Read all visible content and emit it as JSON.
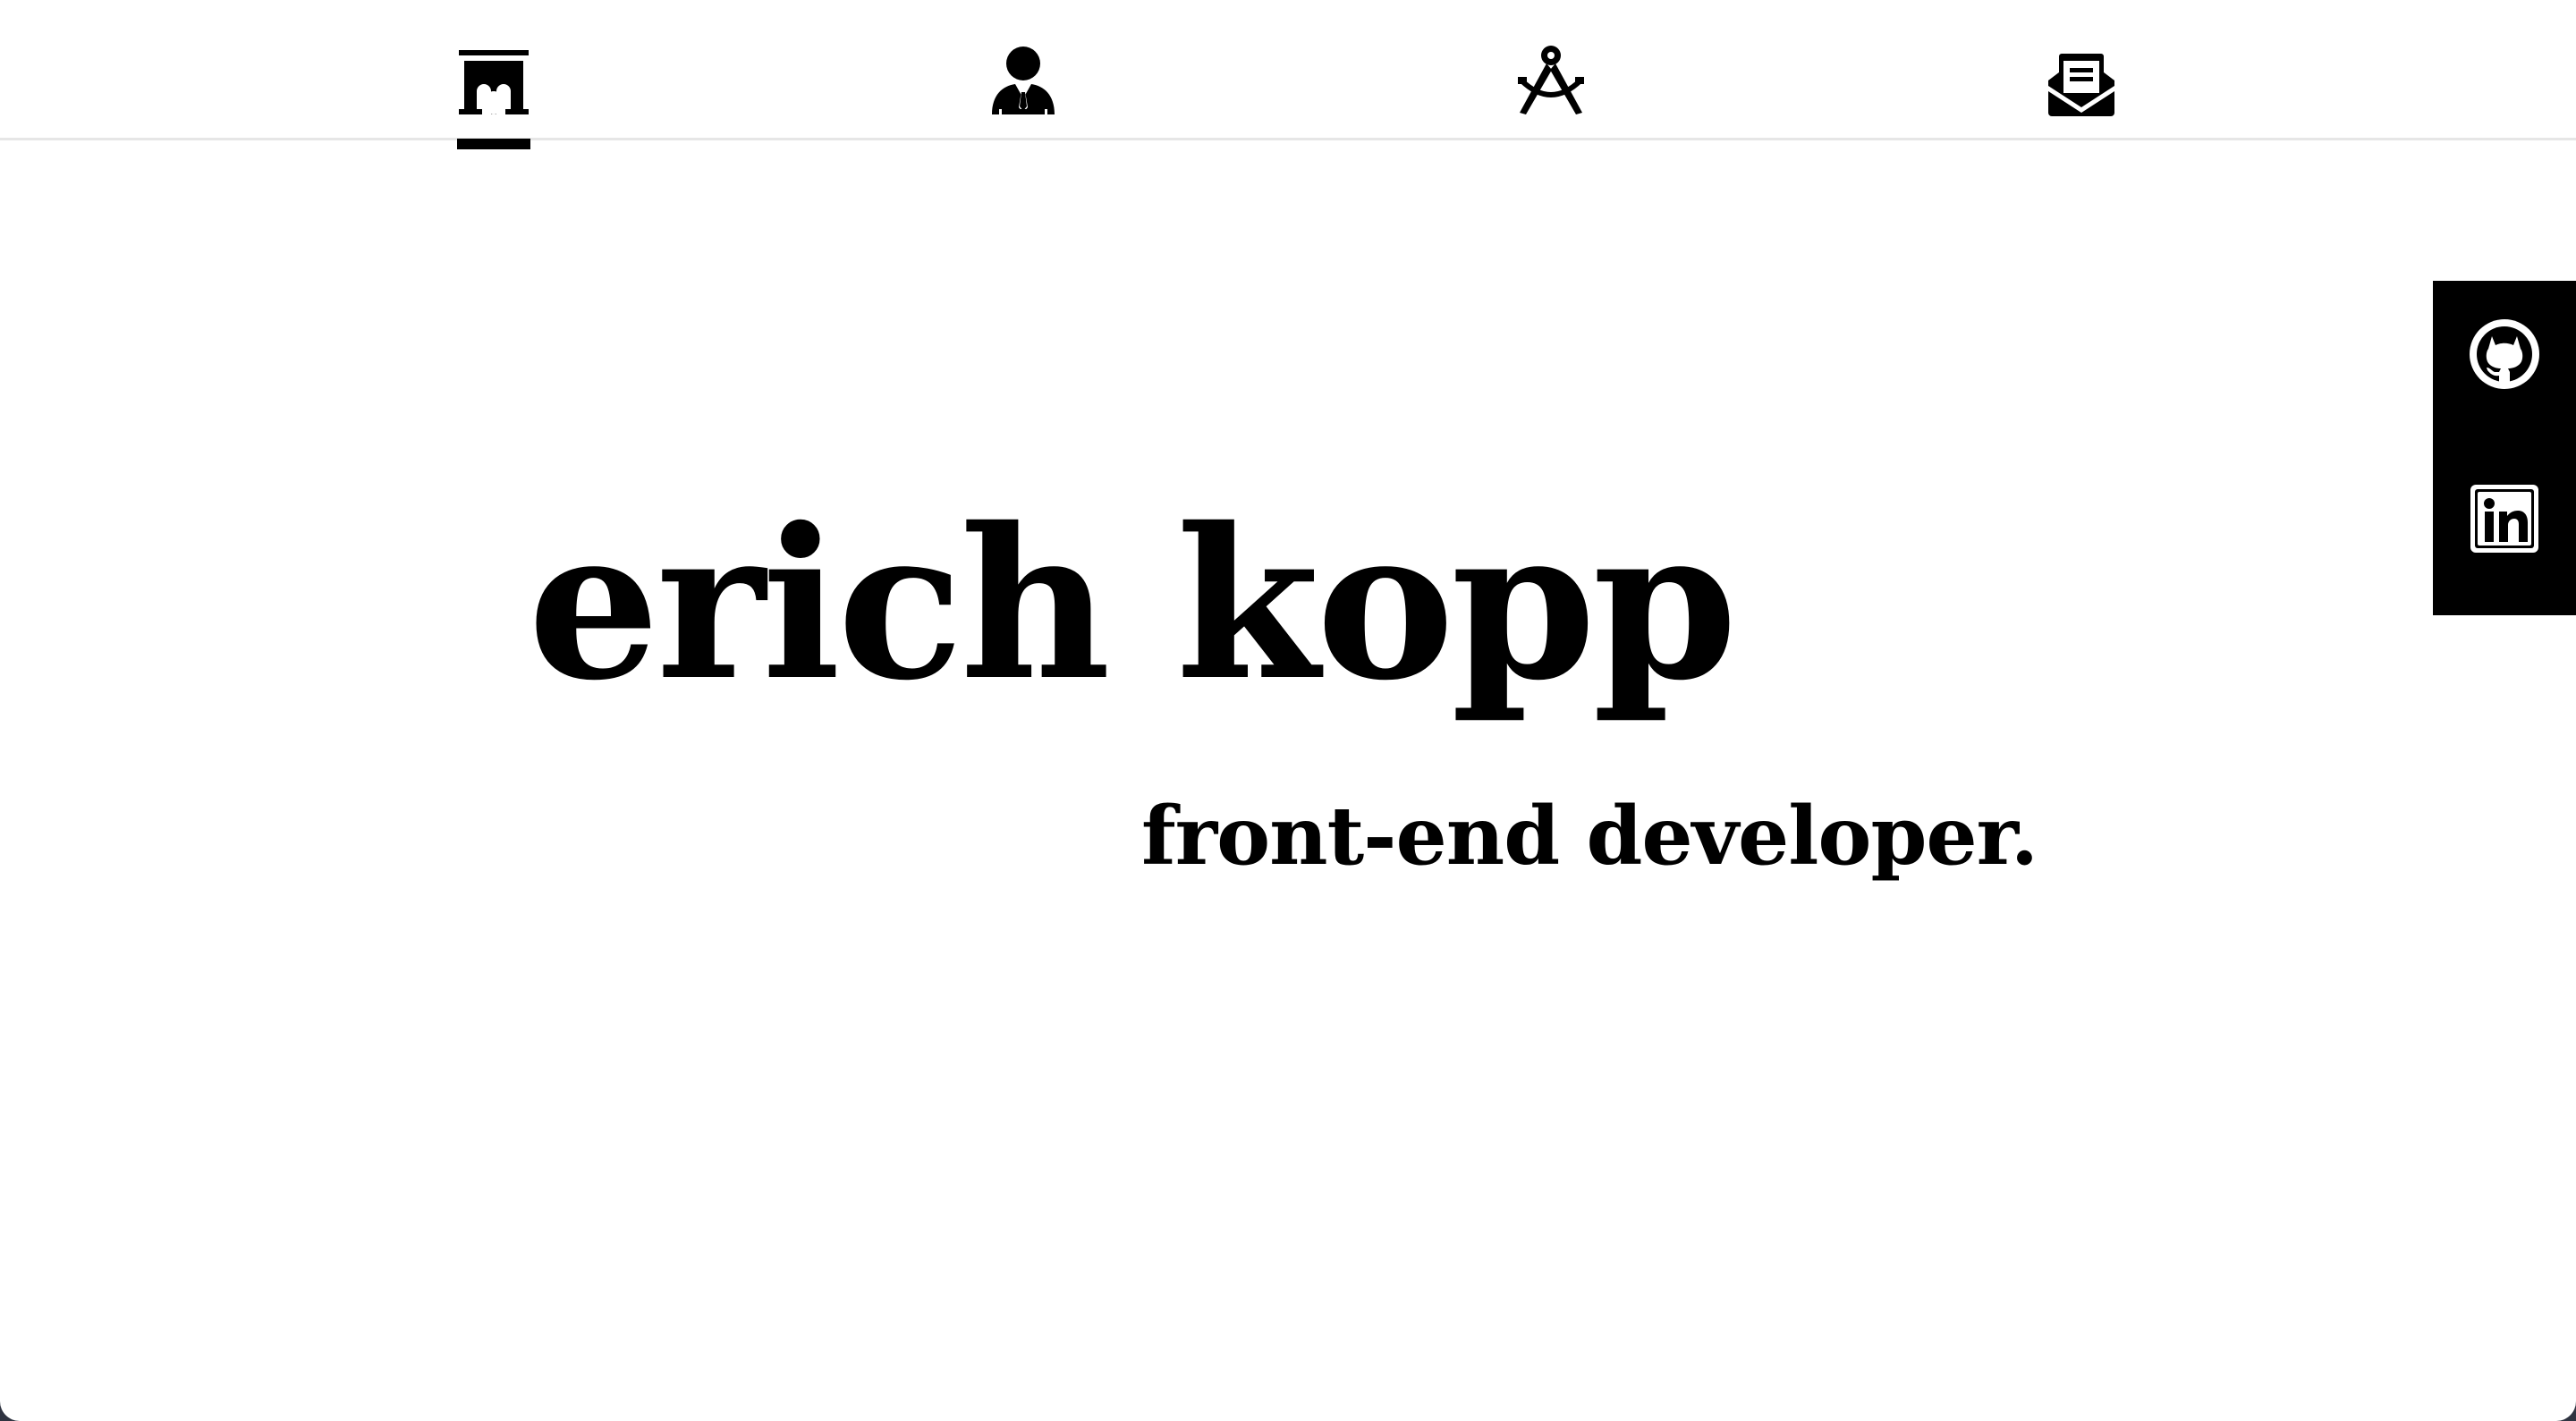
{
  "nav": {
    "items": [
      {
        "id": "home",
        "icon": "arch-icon",
        "active": true
      },
      {
        "id": "about",
        "icon": "person-suit-icon",
        "active": false
      },
      {
        "id": "projects",
        "icon": "drafting-compass-icon",
        "active": false
      },
      {
        "id": "contact",
        "icon": "envelope-letter-icon",
        "active": false
      }
    ]
  },
  "social": {
    "links": [
      {
        "id": "github",
        "icon": "github-icon"
      },
      {
        "id": "linkedin",
        "icon": "linkedin-icon"
      }
    ]
  },
  "hero": {
    "name": "erich kopp",
    "role": "front-end developer."
  },
  "colors": {
    "background": "#ffffff",
    "foreground": "#000000",
    "nav_border": "#e6e6e6",
    "frame": "#2f3441"
  }
}
